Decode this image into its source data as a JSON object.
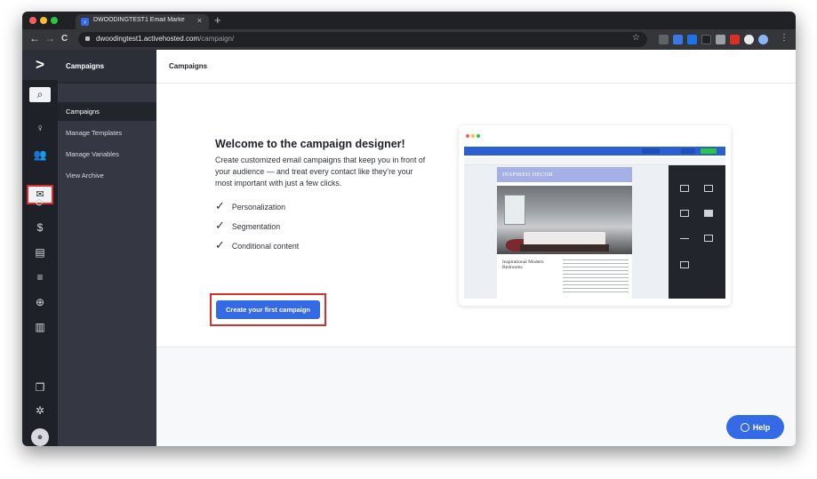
{
  "browser": {
    "tab_title": "DWOODINGTEST1 Email Marke",
    "tab_close": "×",
    "new_tab": "+",
    "url_host": "dwoodingtest1.activehosted.com",
    "url_path": "/campaign/",
    "back": "←",
    "forward": "→",
    "reload": "C",
    "bookmark": "☆"
  },
  "rail": {
    "logo": ">",
    "items": [
      "search-icon",
      "contacts-icon",
      "lists-icon",
      "campaigns-icon",
      "automations-icon",
      "deals-icon",
      "conversations-icon",
      "forms-icon",
      "website-icon",
      "reports-icon",
      "pages-icon",
      "settings-icon",
      "profile-icon"
    ],
    "glyphs": {
      "search": "⌕",
      "contacts": "♀",
      "lists": "👥",
      "campaigns": "✉",
      "automations": "⟳",
      "deals": "$",
      "conversations": "▤",
      "forms": "≡",
      "website": "⊕",
      "reports": "▥",
      "pages": "❐",
      "settings": "✲",
      "profile": "●"
    }
  },
  "sidebar": {
    "title": "Campaigns",
    "items": [
      {
        "label": "Campaigns",
        "active": true
      },
      {
        "label": "Manage Templates",
        "active": false
      },
      {
        "label": "Manage Variables",
        "active": false
      },
      {
        "label": "View Archive",
        "active": false
      }
    ]
  },
  "main": {
    "header_title": "Campaigns",
    "welcome_title": "Welcome to the campaign designer!",
    "welcome_desc": "Create customized email campaigns that keep you in front of your audience — and treat every contact like they’re your most important with just a few clicks.",
    "features": [
      "Personalization",
      "Segmentation",
      "Conditional content"
    ],
    "check_glyph": "✓",
    "cta_label": "Create your first campaign"
  },
  "preview": {
    "banner_text": "INSPIRED DECOR",
    "headline": "Inspirational Modern Bedrooms"
  },
  "help": {
    "label": "Help"
  },
  "colors": {
    "accent": "#356ae6",
    "highlight": "#d92f2f",
    "rail": "#1f2129",
    "sidebar": "#353842"
  }
}
